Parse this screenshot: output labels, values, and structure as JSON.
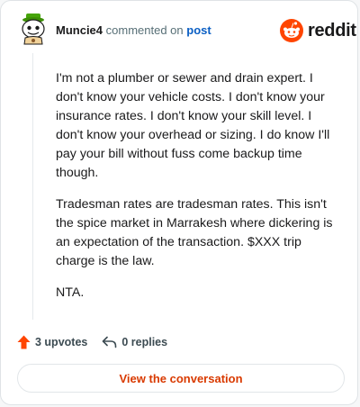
{
  "comment": {
    "username": "Muncie4",
    "action_text": "commented on",
    "target_link": "post",
    "paragraphs": [
      "I'm not a plumber or sewer and drain expert. I don't know your vehicle costs. I don't know your insurance rates. I don't know your skill level. I don't know your overhead or sizing. I do know I'll pay your bill without fuss come backup time though.",
      "Tradesman rates are tradesman rates. This isn't the spice market in Marrakesh where dickering is an expectation of the transaction. $XXX trip charge is the law.",
      "NTA."
    ]
  },
  "brand": {
    "name": "reddit",
    "color": "#ff4500"
  },
  "actions": {
    "upvotes_label": "3 upvotes",
    "replies_label": "0 replies"
  },
  "view_button_label": "View the conversation",
  "icons": {
    "avatar": "avatar-snoo-icon",
    "logo": "reddit-snoo-icon",
    "upvote": "upvote-arrow-icon",
    "reply": "reply-arrow-icon"
  },
  "colors": {
    "upvote": "#ff4500",
    "link": "#0b5fc4",
    "button_text": "#d93a00"
  }
}
